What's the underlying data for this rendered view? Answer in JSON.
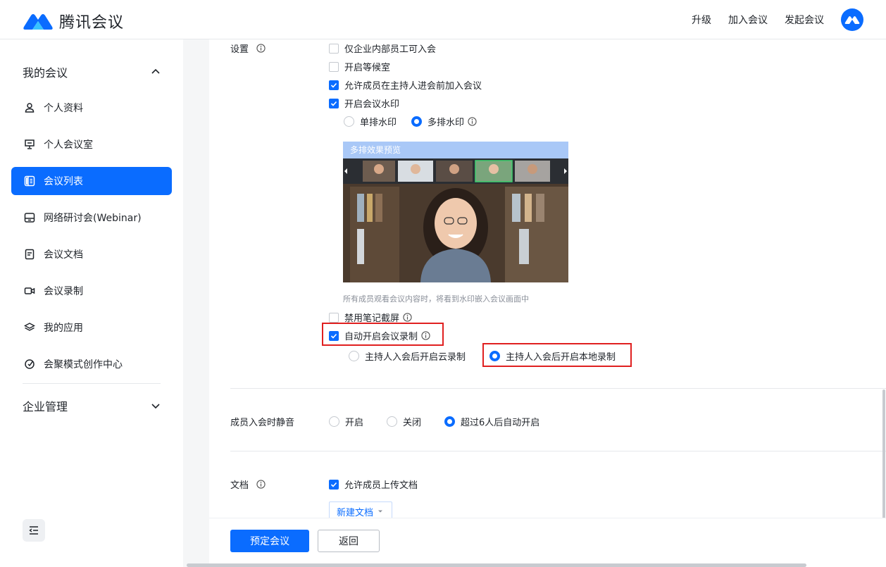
{
  "header": {
    "brand": "腾讯会议",
    "nav": [
      {
        "id": "upgrade",
        "label": "升级"
      },
      {
        "id": "join",
        "label": "加入会议"
      },
      {
        "id": "start",
        "label": "发起会议"
      }
    ]
  },
  "sidebar": {
    "group_my": "我的会议",
    "items": [
      {
        "label": "个人资料",
        "icon": "user-icon"
      },
      {
        "label": "个人会议室",
        "icon": "monitor-icon"
      },
      {
        "label": "会议列表",
        "icon": "list-icon",
        "active": true
      },
      {
        "label": "网络研讨会(Webinar)",
        "icon": "webinar-icon"
      },
      {
        "label": "会议文档",
        "icon": "document-icon"
      },
      {
        "label": "会议录制",
        "icon": "video-icon"
      },
      {
        "label": "我的应用",
        "icon": "layers-icon"
      },
      {
        "label": "会聚模式创作中心",
        "icon": "create-center-icon"
      }
    ],
    "group_enterprise": "企业管理"
  },
  "settings": {
    "label": "设置",
    "options": {
      "internal_only": {
        "label": "仅企业内部员工可入会",
        "checked": false
      },
      "waiting_room": {
        "label": "开启等候室",
        "checked": false
      },
      "join_before_host": {
        "label": "允许成员在主持人进会前加入会议",
        "checked": true
      },
      "watermark": {
        "label": "开启会议水印",
        "checked": true
      }
    },
    "watermark_mode": {
      "single": "单排水印",
      "multi": "多排水印",
      "selected": "multi"
    },
    "preview_title": "多排效果预览",
    "preview_hint": "所有成员观看会议内容时，将看到水印嵌入会议画面中",
    "disable_screenshot": {
      "label": "禁用笔记截屏",
      "checked": false
    },
    "auto_record": {
      "label": "自动开启会议录制",
      "checked": true
    },
    "record_mode": {
      "cloud": "主持人入会后开启云录制",
      "local": "主持人入会后开启本地录制",
      "selected": "local"
    }
  },
  "mute": {
    "label": "成员入会时静音",
    "options": [
      "开启",
      "关闭",
      "超过6人后自动开启"
    ],
    "selected": "超过6人后自动开启"
  },
  "docs": {
    "label": "文档",
    "allow_upload": {
      "label": "允许成员上传文档",
      "checked": true
    },
    "new_doc": "新建文档"
  },
  "footer": {
    "primary": "预定会议",
    "back": "返回"
  },
  "colors": {
    "accent": "#0a6cff",
    "highlight": "#e02020"
  }
}
